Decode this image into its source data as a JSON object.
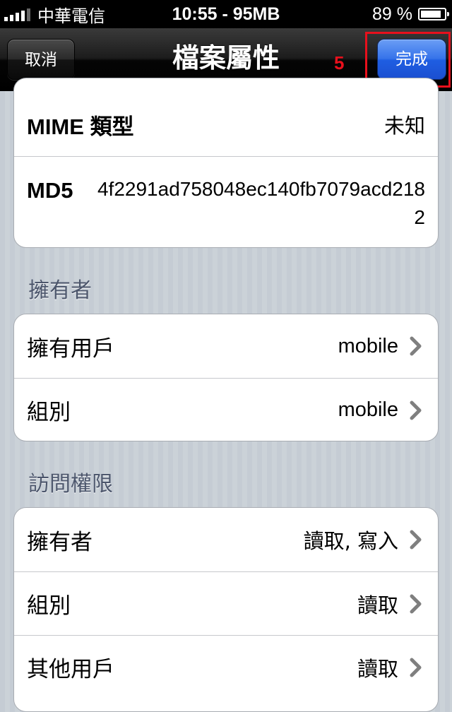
{
  "status_bar": {
    "carrier": "中華電信",
    "time_memory": "10:55 - 95MB",
    "battery_percent": "89 %",
    "battery_level": 0.89
  },
  "nav": {
    "title": "檔案屬性",
    "cancel_label": "取消",
    "done_label": "完成",
    "annotation_number": "5"
  },
  "info_group": {
    "mime_label_prefix": "MIME",
    "mime_label_suffix": "類型",
    "mime_value": "未知",
    "md5_label": "MD5",
    "md5_value": "4f2291ad758048ec140fb7079acd2182"
  },
  "owner_section": {
    "header": "擁有者",
    "rows": [
      {
        "label": "擁有用戶",
        "value": "mobile"
      },
      {
        "label": "組別",
        "value": "mobile"
      }
    ]
  },
  "permissions_section": {
    "header": "訪問權限",
    "rows": [
      {
        "label": "擁有者",
        "value": "讀取, 寫入"
      },
      {
        "label": "組別",
        "value": "讀取"
      },
      {
        "label": "其他用戶",
        "value": "讀取"
      }
    ]
  },
  "colors": {
    "nav_background": "#000000",
    "done_button": "#2a66e6",
    "annotation": "#e8101c",
    "section_header": "#4c566c",
    "table_background": "#c5ccd4"
  }
}
